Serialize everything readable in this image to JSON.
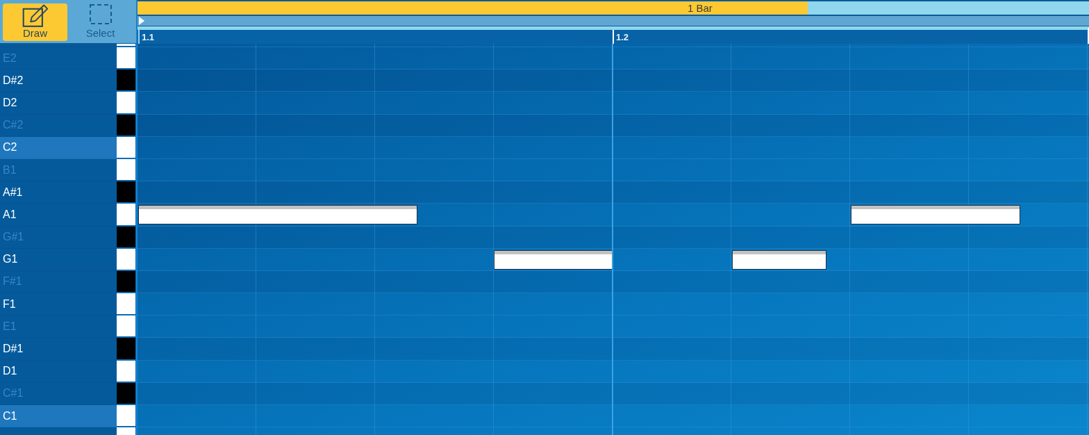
{
  "tools": [
    {
      "label": "Draw",
      "selected": true
    },
    {
      "label": "Select",
      "selected": false
    }
  ],
  "timeline": {
    "region": {
      "label": "1 Bar"
    },
    "ruler_marks": [
      "1.1",
      "1.2"
    ]
  },
  "keyboard": {
    "keys": [
      {
        "kind": "white",
        "highlighted": false
      },
      {
        "label": "E2",
        "kind": "white",
        "dimmed": true,
        "highlighted": false
      },
      {
        "label": "D#2",
        "kind": "black",
        "dimmed": false,
        "highlighted": false
      },
      {
        "label": "D2",
        "kind": "white",
        "dimmed": false,
        "highlighted": false
      },
      {
        "label": "C#2",
        "kind": "black",
        "dimmed": true,
        "highlighted": false
      },
      {
        "label": "C2",
        "kind": "white",
        "dimmed": false,
        "highlighted": true
      },
      {
        "label": "B1",
        "kind": "white",
        "dimmed": true,
        "highlighted": false
      },
      {
        "label": "A#1",
        "kind": "black",
        "dimmed": false,
        "highlighted": false
      },
      {
        "label": "A1",
        "kind": "white",
        "dimmed": false,
        "highlighted": false
      },
      {
        "label": "G#1",
        "kind": "black",
        "dimmed": true,
        "highlighted": false
      },
      {
        "label": "G1",
        "kind": "white",
        "dimmed": false,
        "highlighted": false
      },
      {
        "label": "F#1",
        "kind": "black",
        "dimmed": true,
        "highlighted": false
      },
      {
        "label": "F1",
        "kind": "white",
        "dimmed": false,
        "highlighted": false
      },
      {
        "label": "E1",
        "kind": "white",
        "dimmed": true,
        "highlighted": false
      },
      {
        "label": "D#1",
        "kind": "black",
        "dimmed": false,
        "highlighted": false
      },
      {
        "label": "D1",
        "kind": "white",
        "dimmed": false,
        "highlighted": false
      },
      {
        "label": "C#1",
        "kind": "black",
        "dimmed": true,
        "highlighted": false
      },
      {
        "label": "C1",
        "kind": "white",
        "dimmed": false,
        "highlighted": true
      },
      {
        "kind": "white",
        "highlighted": false
      }
    ]
  }
}
